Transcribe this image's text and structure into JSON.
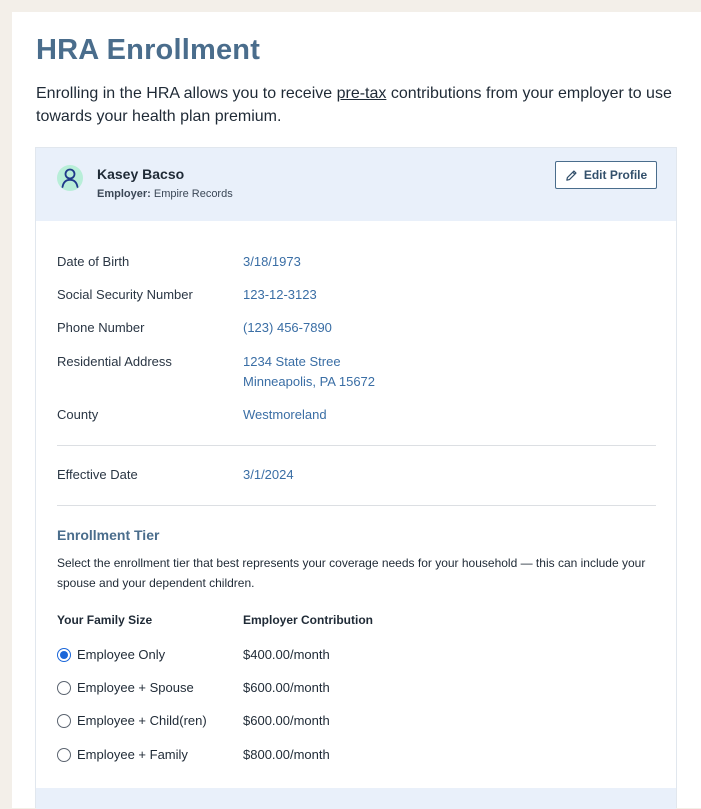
{
  "page": {
    "title": "HRA Enrollment",
    "intro_before": "Enrolling in the HRA allows you to receive ",
    "intro_link": "pre-tax",
    "intro_after": " contributions from your employer to use towards your health plan premium."
  },
  "profile": {
    "name": "Kasey Bacso",
    "employer_label": "Employer:",
    "employer_value": "Empire Records",
    "edit_button": "Edit Profile",
    "avatar_icon": "user-icon",
    "edit_icon": "pencil-icon"
  },
  "details": {
    "dob_label": "Date of Birth",
    "dob_value": "3/18/1973",
    "ssn_label": "Social Security Number",
    "ssn_value": "123-12-3123",
    "phone_label": "Phone Number",
    "phone_value": "(123) 456-7890",
    "address_label": "Residential Address",
    "address_line1": "1234 State Stree",
    "address_line2": "Minneapolis, PA 15672",
    "county_label": "County",
    "county_value": "Westmoreland",
    "effective_label": "Effective Date",
    "effective_value": "3/1/2024"
  },
  "enrollment": {
    "title": "Enrollment Tier",
    "description": "Select the enrollment tier that best represents your coverage needs for your household — this can include your spouse and your dependent children.",
    "col_family": "Your Family Size",
    "col_contribution": "Employer Contribution",
    "tiers": [
      {
        "label": "Employee Only",
        "amount": "$400.00/month",
        "selected": true
      },
      {
        "label": "Employee + Spouse",
        "amount": "$600.00/month",
        "selected": false
      },
      {
        "label": "Employee + Child(ren)",
        "amount": "$600.00/month",
        "selected": false
      },
      {
        "label": "Employee + Family",
        "amount": "$800.00/month",
        "selected": false
      }
    ]
  },
  "colors": {
    "title": "#4a6d8c",
    "value_text": "#3a6ea5",
    "header_bg": "#e9f0fa",
    "avatar_bg": "#b8eed8",
    "radio_selected": "#1a66d9",
    "page_bg": "#f3efe9"
  }
}
